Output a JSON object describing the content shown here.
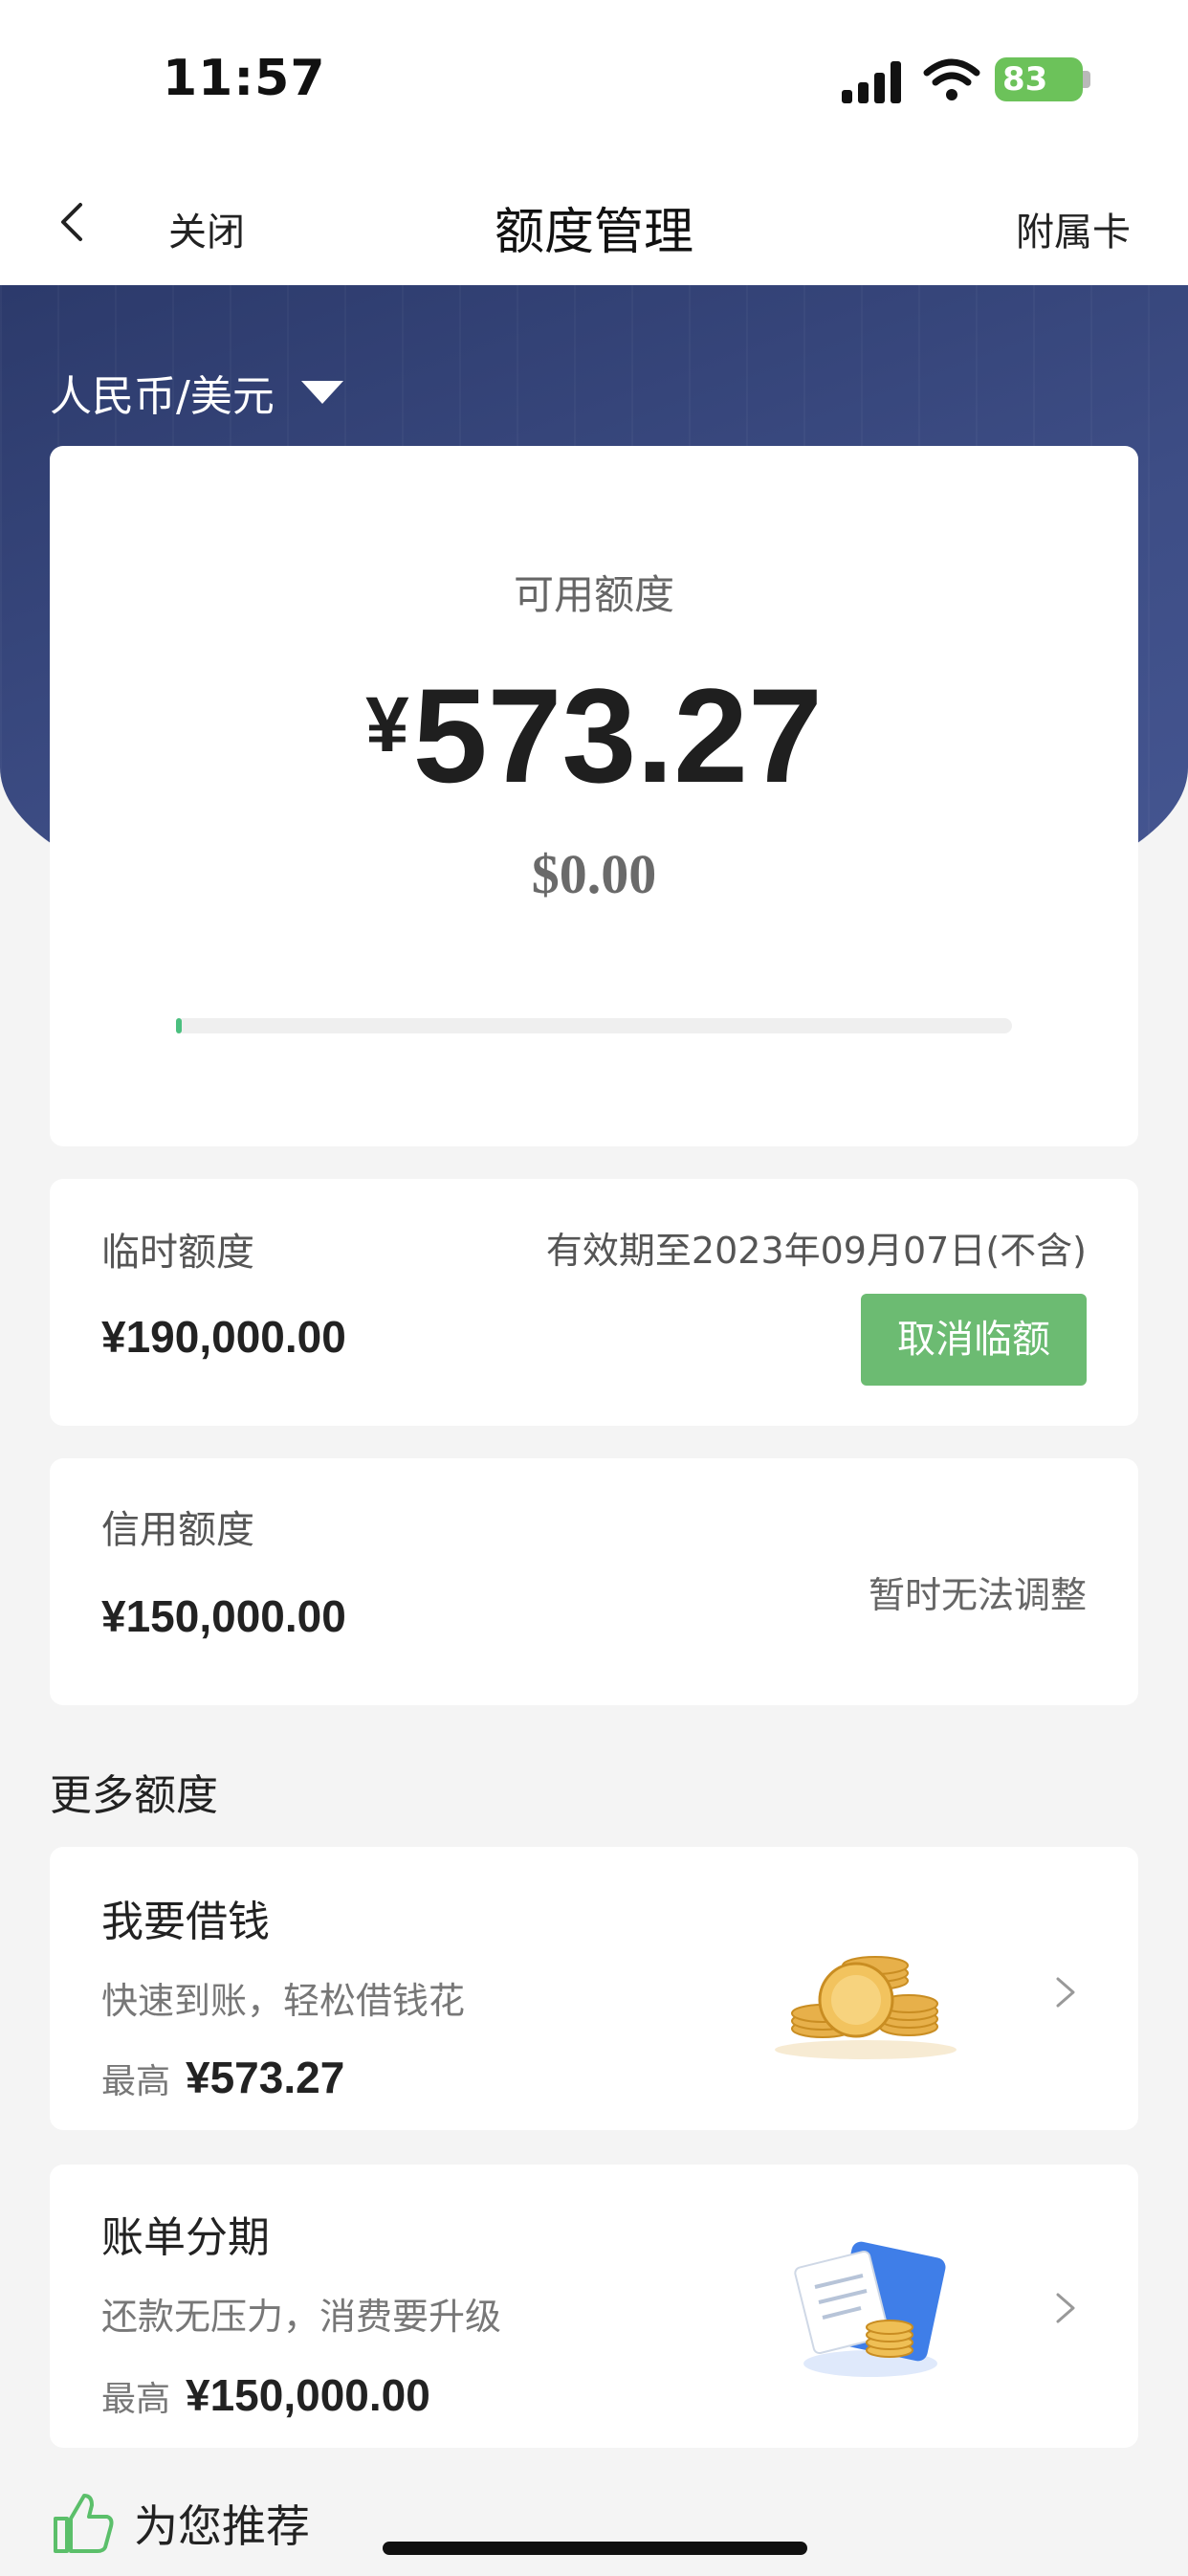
{
  "status_bar": {
    "time": "11:57",
    "battery": "83"
  },
  "nav": {
    "close": "关闭",
    "title": "额度管理",
    "sub_card": "附属卡"
  },
  "currency_selector": "人民币/美元",
  "available": {
    "label": "可用额度",
    "rmb_symbol": "¥",
    "rmb_value": "573.27",
    "usd": "$0.00",
    "progress_percent": 0.3
  },
  "temp_limit": {
    "label": "临时额度",
    "valid_until": "有效期至2023年09月07日(不含)",
    "amount": "¥190,000.00",
    "cancel_button": "取消临额"
  },
  "credit_limit": {
    "label": "信用额度",
    "amount": "¥150,000.00",
    "status": "暂时无法调整"
  },
  "more": {
    "title": "更多额度",
    "items": [
      {
        "title": "我要借钱",
        "subtitle": "快速到账，轻松借钱花",
        "max_label": "最高",
        "max_value": "¥573.27",
        "image": "gold-coins-icon"
      },
      {
        "title": "账单分期",
        "subtitle": "还款无压力，消费要升级",
        "max_label": "最高",
        "max_value": "¥150,000.00",
        "image": "bill-card-icon"
      }
    ]
  },
  "recommend": "为您推荐",
  "colors": {
    "header_blue": "#2c3a6b",
    "accent_green": "#6cbb72",
    "progress_green": "#4bbf7f"
  }
}
